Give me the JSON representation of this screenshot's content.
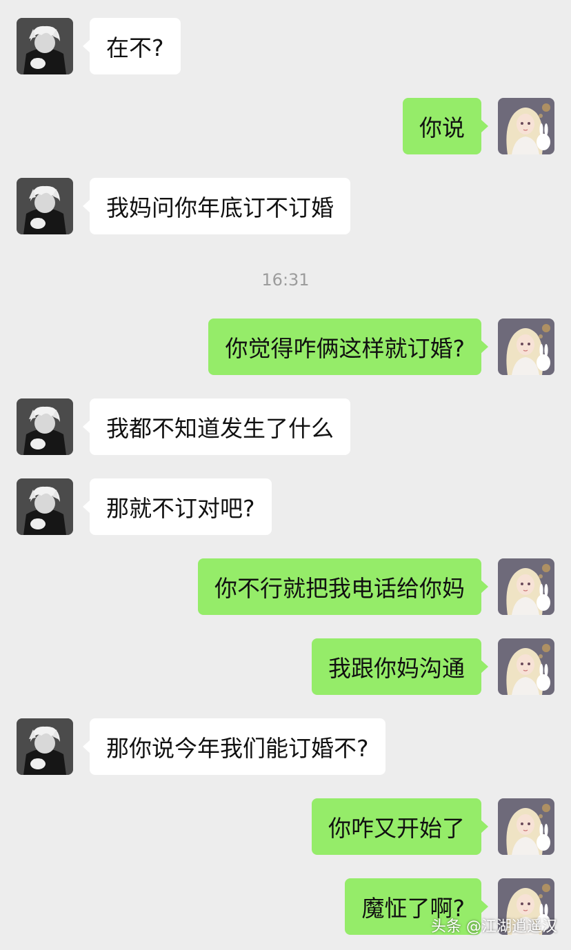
{
  "timestamp": "16:31",
  "watermark": "头条 @江湖逍遥汉",
  "avatars": {
    "contact": "boy-avatar-icon",
    "self": "girl-avatar-icon"
  },
  "colors": {
    "background": "#ededed",
    "incoming_bubble": "#ffffff",
    "outgoing_bubble": "#95ec69"
  },
  "messages": [
    {
      "from": "contact",
      "text": "在不?"
    },
    {
      "from": "self",
      "text": "你说"
    },
    {
      "from": "contact",
      "text": "我妈问你年底订不订婚"
    },
    {
      "from": "self",
      "text": "你觉得咋俩这样就订婚?"
    },
    {
      "from": "contact",
      "text": "我都不知道发生了什么"
    },
    {
      "from": "contact",
      "text": "那就不订对吧?"
    },
    {
      "from": "self",
      "text": "你不行就把我电话给你妈"
    },
    {
      "from": "self",
      "text": "我跟你妈沟通"
    },
    {
      "from": "contact",
      "text": "那你说今年我们能订婚不?"
    },
    {
      "from": "self",
      "text": "你咋又开始了"
    },
    {
      "from": "self",
      "text": "魔怔了啊?"
    }
  ]
}
